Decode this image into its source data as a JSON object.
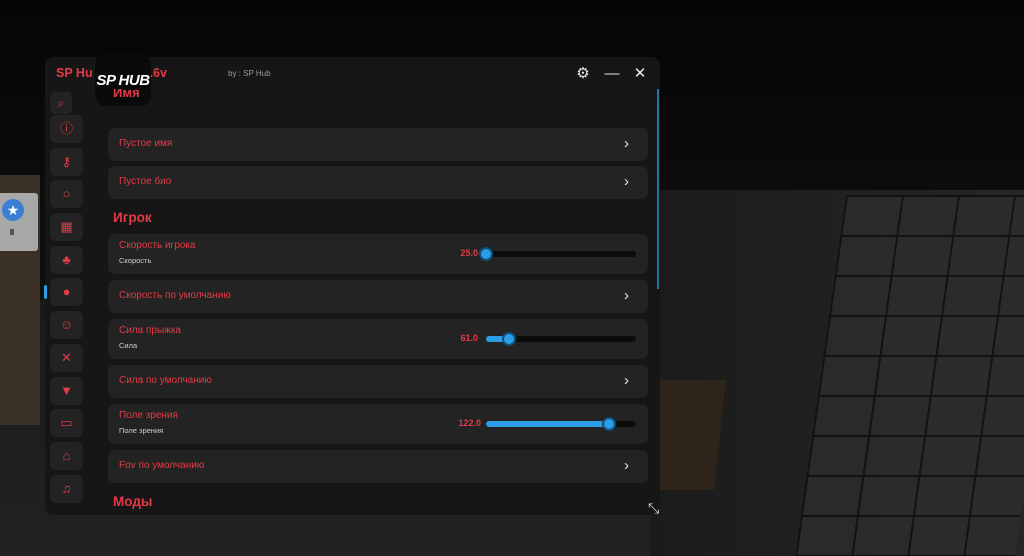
{
  "app": {
    "title": "SP Hu       haven | 1.6v",
    "by": "by : SP Hub",
    "logo": "SP HUB"
  },
  "titlebar": {
    "settings_icon": "gear-icon",
    "minimize_icon": "minimize-icon",
    "close_icon": "close-icon"
  },
  "sidebar": {
    "items": [
      {
        "icon": "search-icon",
        "glyph": "⌕"
      },
      {
        "icon": "info-icon",
        "glyph": "ⓘ"
      },
      {
        "icon": "key-icon",
        "glyph": "⚷"
      },
      {
        "icon": "circle-icon",
        "glyph": "○"
      },
      {
        "icon": "buildings-icon",
        "glyph": "▦"
      },
      {
        "icon": "tree-icon",
        "glyph": "♣"
      },
      {
        "icon": "user-icon",
        "glyph": "●"
      },
      {
        "icon": "face-icon",
        "glyph": "☺"
      },
      {
        "icon": "tools-icon",
        "glyph": "✕"
      },
      {
        "icon": "shirt-icon",
        "glyph": "▼"
      },
      {
        "icon": "car-icon",
        "glyph": "▭"
      },
      {
        "icon": "house-icon",
        "glyph": "⌂"
      },
      {
        "icon": "music-icon",
        "glyph": "♫"
      }
    ],
    "active_index": 6
  },
  "content": {
    "partial_heading": "Имя",
    "rows_top": [
      {
        "label": "Пустое имя"
      },
      {
        "label": "Пустое био"
      }
    ],
    "player_heading": "Игрок",
    "player_rows": {
      "speed": {
        "label": "Скорость игрока",
        "sub": "Скорость",
        "value": "25.0",
        "fill": 0.0
      },
      "speed_default": {
        "label": "Скорость по умолчанию"
      },
      "jump": {
        "label": "Сила прыжка",
        "sub": "Сила",
        "value": "61.0",
        "fill": 0.15
      },
      "jump_default": {
        "label": "Сила по умолчанию"
      },
      "fov": {
        "label": "Поле зрения",
        "sub": "Поле зрения",
        "value": "122.0",
        "fill": 0.82
      },
      "fov_default": {
        "label": "Fov по умолчанию"
      }
    },
    "mods_heading": "Моды"
  },
  "colors": {
    "accent_red": "#e33b46",
    "accent_blue": "#2a9de6",
    "panel": "#161616",
    "row": "#232323"
  }
}
